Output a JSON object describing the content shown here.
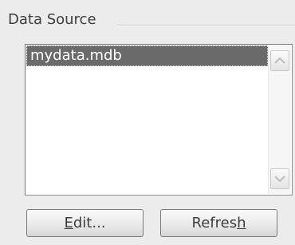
{
  "group": {
    "title": "Data Source"
  },
  "list": {
    "items": [
      {
        "label": "mydata.mdb",
        "selected": true
      }
    ]
  },
  "scrollbar": {
    "up_icon": "chevron-up-icon",
    "down_icon": "chevron-down-icon"
  },
  "buttons": {
    "edit": {
      "mnemonic": "E",
      "rest": "dit..."
    },
    "refresh": {
      "before": "Refres",
      "mnemonic": "h"
    }
  },
  "colors": {
    "background": "#ececec",
    "list_background": "#ffffff",
    "selection": "#6a6a6a",
    "text": "#3d3d3d"
  }
}
